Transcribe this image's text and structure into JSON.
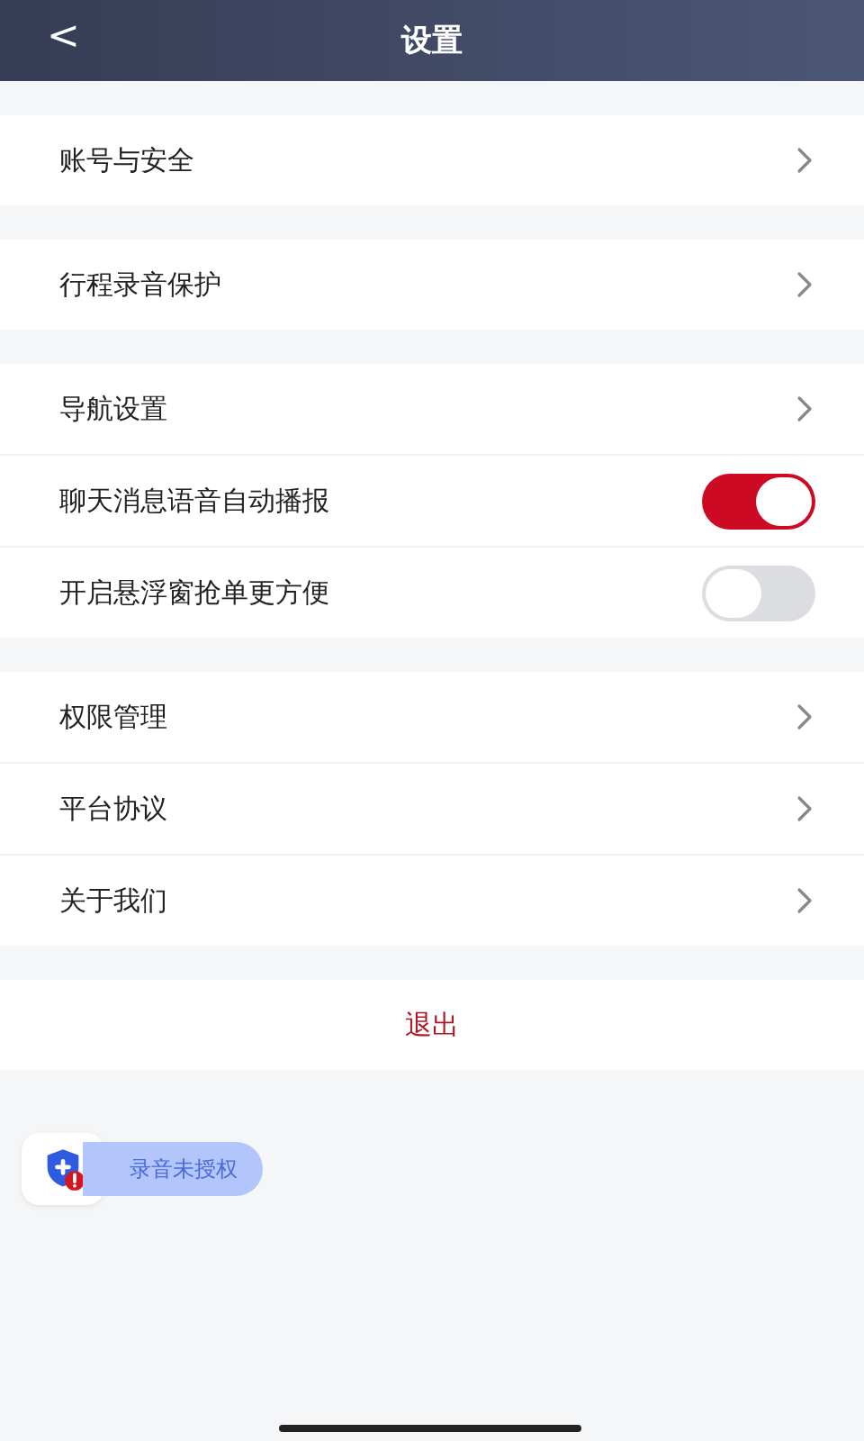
{
  "header": {
    "back": "<",
    "title": "设置"
  },
  "groups": [
    {
      "rows": [
        {
          "kind": "link",
          "label": "账号与安全"
        }
      ]
    },
    {
      "rows": [
        {
          "kind": "link",
          "label": "行程录音保护"
        }
      ]
    },
    {
      "rows": [
        {
          "kind": "link",
          "label": "导航设置"
        },
        {
          "kind": "toggle",
          "label": "聊天消息语音自动播报",
          "on": true
        },
        {
          "kind": "toggle",
          "label": "开启悬浮窗抢单更方便",
          "on": false
        }
      ]
    },
    {
      "rows": [
        {
          "kind": "link",
          "label": "权限管理"
        },
        {
          "kind": "link",
          "label": "平台协议"
        },
        {
          "kind": "link",
          "label": "关于我们"
        }
      ]
    }
  ],
  "logout": "退出",
  "recording_badge": {
    "label": "录音未授权"
  }
}
